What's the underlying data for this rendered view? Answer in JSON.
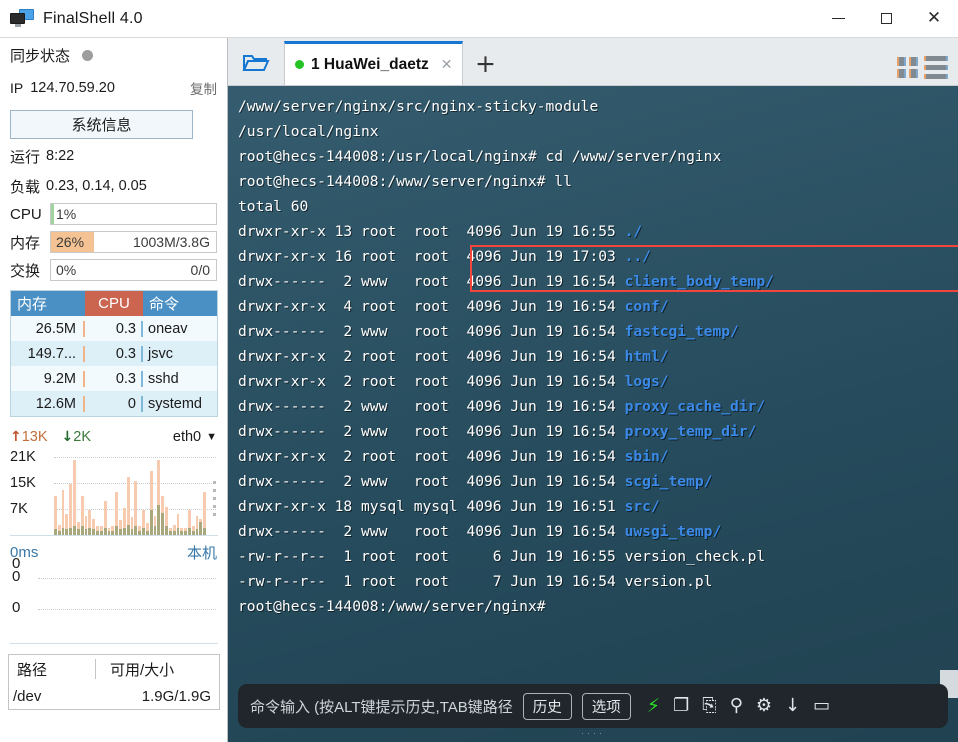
{
  "window": {
    "title": "FinalShell 4.0",
    "icon": "monitor-icon",
    "minimize": "—",
    "maximize": "□",
    "close": "✕"
  },
  "sidebar": {
    "sync": {
      "label": "同步状态",
      "status_color": "#9d9d9d"
    },
    "ip": {
      "label": "IP",
      "value": "124.70.59.20",
      "copy": "复制"
    },
    "sysinfo_button": "系统信息",
    "uptime": {
      "label": "运行",
      "value": "8:22"
    },
    "load": {
      "label": "负载",
      "value": "0.23, 0.14, 0.05"
    },
    "meters": [
      {
        "key": "CPU",
        "pct": "1%",
        "pct_num": 1,
        "right": "",
        "fill": "#9fd49f"
      },
      {
        "key": "内存",
        "pct": "26%",
        "pct_num": 26,
        "right": "1003M/3.8G",
        "fill": "#f5c393"
      },
      {
        "key": "交换",
        "pct": "0%",
        "pct_num": 0,
        "right": "0/0",
        "fill": "#cccccc"
      }
    ],
    "processes": {
      "headers": [
        "内存",
        "CPU",
        "命令"
      ],
      "header_colors": {
        "mem": "#4a90c4",
        "cpu": "#cc6550",
        "cmd": "#4a90c4"
      },
      "rows": [
        {
          "mem": "26.5M",
          "cpu": "0.3",
          "cmd": "oneav"
        },
        {
          "mem": "149.7...",
          "cpu": "0.3",
          "cmd": "jsvc"
        },
        {
          "mem": "9.2M",
          "cpu": "0.3",
          "cmd": "sshd"
        },
        {
          "mem": "12.6M",
          "cpu": "0",
          "cmd": "systemd"
        }
      ]
    },
    "network": {
      "up_arrow": "↑",
      "up": "13K",
      "down_arrow": "↓",
      "down": "2K",
      "interface": "eth0",
      "caret": "▼",
      "y_labels": [
        "21K",
        "15K",
        "7K"
      ],
      "bars_up": [
        52,
        14,
        60,
        28,
        68,
        100,
        18,
        52,
        26,
        34,
        22,
        12,
        12,
        46,
        10,
        12,
        58,
        20,
        36,
        78,
        24,
        72,
        12,
        34,
        16,
        86,
        26,
        100,
        52,
        38,
        10,
        14,
        28,
        10,
        10,
        34,
        12,
        26,
        22,
        58
      ],
      "bars_dn": [
        8,
        6,
        10,
        8,
        10,
        12,
        8,
        12,
        8,
        10,
        8,
        6,
        6,
        10,
        6,
        6,
        12,
        8,
        10,
        14,
        8,
        12,
        6,
        10,
        6,
        34,
        12,
        40,
        30,
        12,
        6,
        6,
        10,
        6,
        6,
        10,
        6,
        8,
        18,
        10
      ]
    },
    "ping": {
      "value": "0ms",
      "host": "本机",
      "y_labels": [
        "0",
        "0",
        "0"
      ]
    },
    "disk": {
      "headers": [
        "路径",
        "可用/大小"
      ],
      "rows": [
        {
          "path": "/dev",
          "value": "1.9G/1.9G"
        }
      ]
    }
  },
  "tabbar": {
    "folder_icon": "open-folder-icon",
    "tabs": [
      {
        "status_dot": "#23c423",
        "label": "1 HuaWei_daetz",
        "close": "✕",
        "active": true
      }
    ],
    "new_tab": "+",
    "grid_view_icon": "grid-view-icon",
    "list_view_icon": "list-view-icon"
  },
  "terminal": {
    "background": "#2a5467",
    "highlight_color": "#f2453d",
    "lines": [
      [
        {
          "t": "/www/server/nginx/src/nginx-sticky-module",
          "c": "w"
        }
      ],
      [
        {
          "t": "/usr/local/nginx",
          "c": "w"
        }
      ],
      [
        {
          "t": "root@hecs-144008:/usr/local/nginx# cd /www/server/nginx",
          "c": "w"
        }
      ],
      [
        {
          "t": "root@hecs-144008:/www/server/nginx# ll",
          "c": "w"
        }
      ],
      [
        {
          "t": "total 60",
          "c": "w"
        }
      ],
      [
        {
          "t": "drwxr-xr-x 13 root  root  4096 Jun 19 16:55 ",
          "c": "w"
        },
        {
          "t": "./",
          "c": "b"
        }
      ],
      [
        {
          "t": "drwxr-xr-x 16 root  root  4096 Jun 19 17:03 ",
          "c": "w"
        },
        {
          "t": "../",
          "c": "b"
        }
      ],
      [
        {
          "t": "drwx------  2 www   root  4096 Jun 19 16:54 ",
          "c": "w"
        },
        {
          "t": "client_body_temp/",
          "c": "b"
        }
      ],
      [
        {
          "t": "drwxr-xr-x  4 root  root  4096 Jun 19 16:54 ",
          "c": "w"
        },
        {
          "t": "conf/",
          "c": "b"
        }
      ],
      [
        {
          "t": "drwx------  2 www   root  4096 Jun 19 16:54 ",
          "c": "w"
        },
        {
          "t": "fastcgi_temp/",
          "c": "b"
        }
      ],
      [
        {
          "t": "drwxr-xr-x  2 root  root  4096 Jun 19 16:54 ",
          "c": "w"
        },
        {
          "t": "html/",
          "c": "b"
        }
      ],
      [
        {
          "t": "drwxr-xr-x  2 root  root  4096 Jun 19 16:54 ",
          "c": "w"
        },
        {
          "t": "logs/",
          "c": "b"
        }
      ],
      [
        {
          "t": "drwx------  2 www   root  4096 Jun 19 16:54 ",
          "c": "w"
        },
        {
          "t": "proxy_cache_dir/",
          "c": "b"
        }
      ],
      [
        {
          "t": "drwx------  2 www   root  4096 Jun 19 16:54 ",
          "c": "w"
        },
        {
          "t": "proxy_temp_dir/",
          "c": "b"
        }
      ],
      [
        {
          "t": "drwxr-xr-x  2 root  root  4096 Jun 19 16:54 ",
          "c": "w"
        },
        {
          "t": "sbin/",
          "c": "b"
        }
      ],
      [
        {
          "t": "drwx------  2 www   root  4096 Jun 19 16:54 ",
          "c": "w"
        },
        {
          "t": "scgi_temp/",
          "c": "b"
        }
      ],
      [
        {
          "t": "drwxr-xr-x 18 mysql mysql 4096 Jun 19 16:51 ",
          "c": "w"
        },
        {
          "t": "src/",
          "c": "b"
        }
      ],
      [
        {
          "t": "drwx------  2 www   root  4096 Jun 19 16:54 ",
          "c": "w"
        },
        {
          "t": "uwsgi_temp/",
          "c": "b"
        }
      ],
      [
        {
          "t": "-rw-r--r--  1 root  root     6 Jun 19 16:55 version_check.pl",
          "c": "w"
        }
      ],
      [
        {
          "t": "-rw-r--r--  1 root  root     7 Jun 19 16:54 version.pl",
          "c": "w"
        }
      ],
      [
        {
          "t": "root@hecs-144008:/www/server/nginx#",
          "c": "w"
        }
      ]
    ]
  },
  "command_bar": {
    "placeholder": "命令输入 (按ALT键提示历史,TAB键路径",
    "history_button": "历史",
    "options_button": "选项",
    "icons": [
      {
        "name": "lightning-icon",
        "glyph": "⚡"
      },
      {
        "name": "copy-icon",
        "glyph": "❐"
      },
      {
        "name": "paste-icon",
        "glyph": "⎘"
      },
      {
        "name": "search-icon",
        "glyph": "⚲"
      },
      {
        "name": "gear-icon",
        "glyph": "⚙"
      },
      {
        "name": "download-icon",
        "glyph": "↓"
      },
      {
        "name": "window-icon",
        "glyph": "▭"
      }
    ],
    "drag_dots": "····"
  }
}
